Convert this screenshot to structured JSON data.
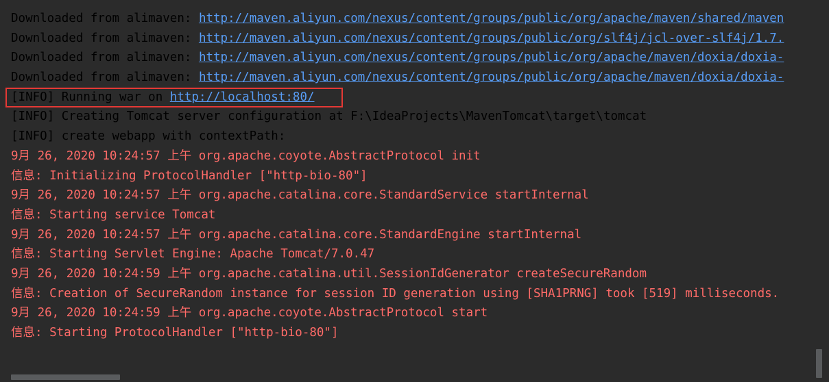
{
  "console": {
    "lines": [
      {
        "prefix": "Downloaded from alimaven: ",
        "link": "http://maven.aliyun.com/nexus/content/groups/public/org/apache/maven/shared/maven",
        "style": "normal"
      },
      {
        "prefix": "Downloaded from alimaven: ",
        "link": "http://maven.aliyun.com/nexus/content/groups/public/org/slf4j/jcl-over-slf4j/1.7.",
        "style": "normal"
      },
      {
        "prefix": "Downloaded from alimaven: ",
        "link": "http://maven.aliyun.com/nexus/content/groups/public/org/apache/maven/doxia/doxia-",
        "style": "normal"
      },
      {
        "prefix": "Downloaded from alimaven: ",
        "link": "http://maven.aliyun.com/nexus/content/groups/public/org/apache/maven/doxia/doxia-",
        "style": "normal"
      },
      {
        "prefix": "[INFO] Running war on ",
        "link": "http://localhost:80/",
        "style": "normal"
      },
      {
        "prefix": "[INFO] Creating Tomcat server configuration at F:\\IdeaProjects\\MavenTomcat\\target\\tomcat",
        "link": "",
        "style": "normal"
      },
      {
        "prefix": "[INFO] create webapp with contextPath:",
        "link": "",
        "style": "normal"
      },
      {
        "prefix": "9月 26, 2020 10:24:57 上午 org.apache.coyote.AbstractProtocol init",
        "link": "",
        "style": "error"
      },
      {
        "prefix": "信息: Initializing ProtocolHandler [\"http-bio-80\"]",
        "link": "",
        "style": "error"
      },
      {
        "prefix": "9月 26, 2020 10:24:57 上午 org.apache.catalina.core.StandardService startInternal",
        "link": "",
        "style": "error"
      },
      {
        "prefix": "信息: Starting service Tomcat",
        "link": "",
        "style": "error"
      },
      {
        "prefix": "9月 26, 2020 10:24:57 上午 org.apache.catalina.core.StandardEngine startInternal",
        "link": "",
        "style": "error"
      },
      {
        "prefix": "信息: Starting Servlet Engine: Apache Tomcat/7.0.47",
        "link": "",
        "style": "error"
      },
      {
        "prefix": "9月 26, 2020 10:24:59 上午 org.apache.catalina.util.SessionIdGenerator createSecureRandom",
        "link": "",
        "style": "error"
      },
      {
        "prefix": "信息: Creation of SecureRandom instance for session ID generation using [SHA1PRNG] took [519] milliseconds.",
        "link": "",
        "style": "error"
      },
      {
        "prefix": "9月 26, 2020 10:24:59 上午 org.apache.coyote.AbstractProtocol start",
        "link": "",
        "style": "error"
      },
      {
        "prefix": "信息: Starting ProtocolHandler [\"http-bio-80\"]",
        "link": "",
        "style": "error"
      }
    ]
  },
  "colors": {
    "background": "#2b2b2b",
    "normal_text": "#bbbbbb",
    "error_text": "#ff6b68",
    "link": "#589df6",
    "highlight_border": "#e53935"
  }
}
